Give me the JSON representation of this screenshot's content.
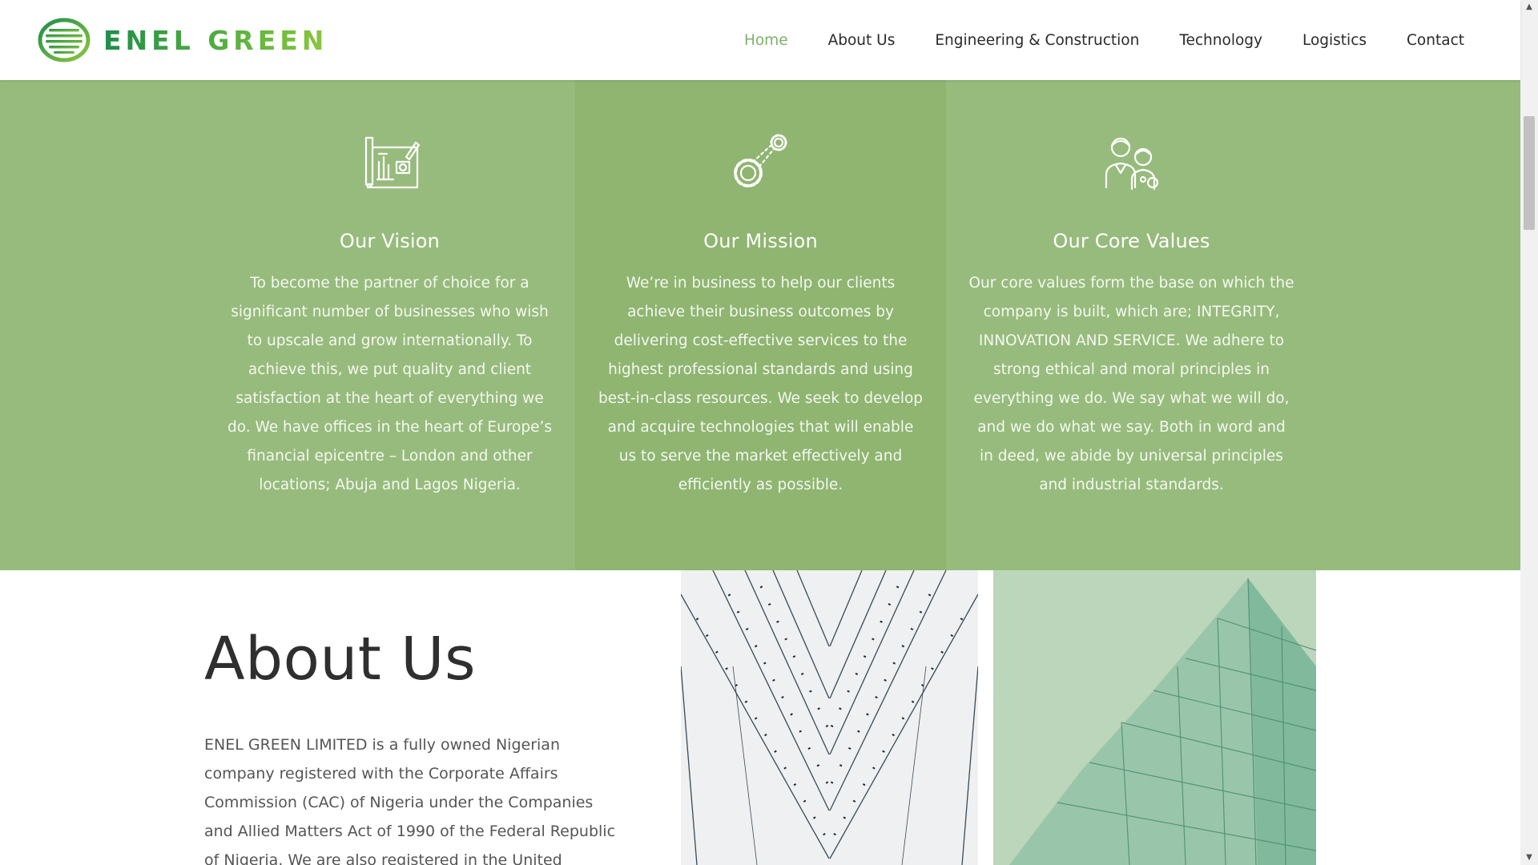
{
  "header": {
    "logo_text": "ENEL GREEN",
    "nav": [
      {
        "label": "Home",
        "active": true
      },
      {
        "label": "About Us",
        "active": false
      },
      {
        "label": "Engineering & Construction",
        "active": false
      },
      {
        "label": "Technology",
        "active": false
      },
      {
        "label": "Logistics",
        "active": false
      },
      {
        "label": "Contact",
        "active": false
      }
    ]
  },
  "pillars": {
    "vision": {
      "icon": "blueprint-icon",
      "title": "Our Vision",
      "text": "To become the partner of choice for a significant number of businesses who wish to upscale and grow internationally. To achieve this, we put quality and client satisfaction at the heart of everything we do. We have offices in the heart of Europe’s financial epicentre – London and other locations; Abuja and Lagos Nigeria."
    },
    "mission": {
      "icon": "gears-icon",
      "title": "Our Mission",
      "text": "We’re in business to help our clients achieve their business outcomes by delivering cost-effective services to the highest professional standards and using best-in-class resources. We seek to develop and acquire technologies that will enable us to serve the market effectively and efficiently as possible."
    },
    "values": {
      "icon": "team-icon",
      "title": "Our Core Values",
      "text": "Our core values form the base on which the company is built, which are; INTEGRITY, INNOVATION AND SERVICE. We adhere to strong ethical and moral principles in everything we do. We say what we will do, and we do what we say. Both in word and in deed, we abide by universal principles and industrial standards."
    }
  },
  "about": {
    "title": "About Us",
    "text": "ENEL GREEN LIMITED is a fully owned Nigerian company registered with the Corporate Affairs Commission (CAC) of Nigeria under the Companies and Allied Matters Act of 1990 of the Federal Republic of Nigeria. We are also registered in the United Kingdom"
  },
  "colors": {
    "brand_green": "#5cb33f",
    "band_green": "#97bb7c",
    "band_green_dark": "#8fb571",
    "nav_active": "#7fb069"
  }
}
